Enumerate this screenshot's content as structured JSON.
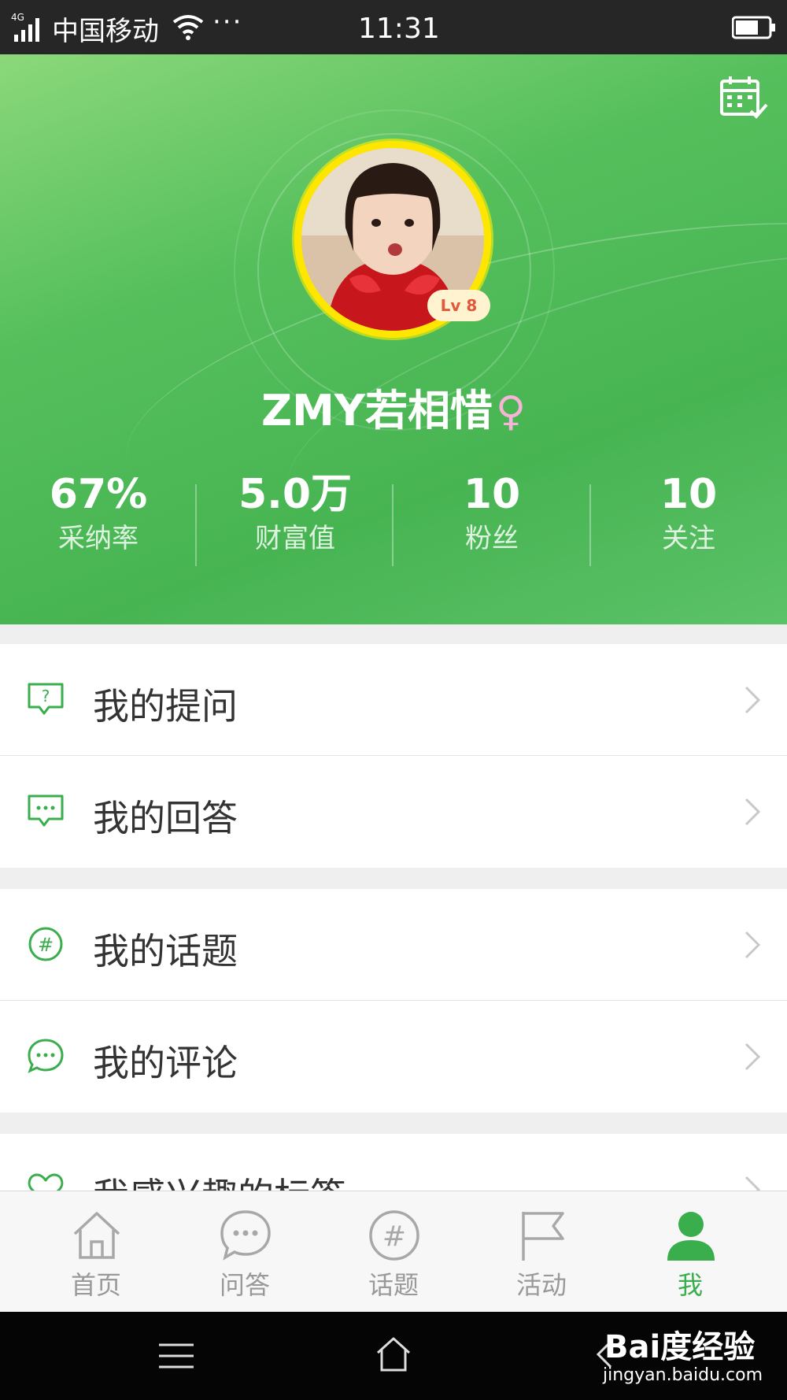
{
  "status_bar": {
    "network": "4G",
    "carrier": "中国移动",
    "more": "···",
    "time": "11:31"
  },
  "profile": {
    "level": "Lv 8",
    "username": "ZMY若相惜",
    "gender_symbol": "♀"
  },
  "stats": [
    {
      "value": "67%",
      "label": "采纳率"
    },
    {
      "value": "5.0万",
      "label": "财富值"
    },
    {
      "value": "10",
      "label": "粉丝"
    },
    {
      "value": "10",
      "label": "关注"
    }
  ],
  "menu": {
    "group1": [
      {
        "label": "我的提问",
        "icon": "question-bubble-icon"
      },
      {
        "label": "我的回答",
        "icon": "answer-bubble-icon"
      }
    ],
    "group2": [
      {
        "label": "我的话题",
        "icon": "hashtag-icon"
      },
      {
        "label": "我的评论",
        "icon": "comment-icon"
      }
    ],
    "group3": [
      {
        "label": "我感兴趣的标签",
        "icon": "heart-icon"
      }
    ]
  },
  "tabs": [
    {
      "label": "首页",
      "icon": "home-icon"
    },
    {
      "label": "问答",
      "icon": "chat-icon"
    },
    {
      "label": "话题",
      "icon": "hashtag-icon"
    },
    {
      "label": "活动",
      "icon": "flag-icon"
    },
    {
      "label": "我",
      "icon": "user-icon",
      "active": true
    }
  ],
  "watermark": {
    "brand": "Bai度经验",
    "url": "jingyan.baidu.com"
  },
  "colors": {
    "accent_green": "#3aae4d",
    "header_green": "#4cb857",
    "level_text": "#e2583b",
    "avatar_ring": "#ffe600"
  }
}
